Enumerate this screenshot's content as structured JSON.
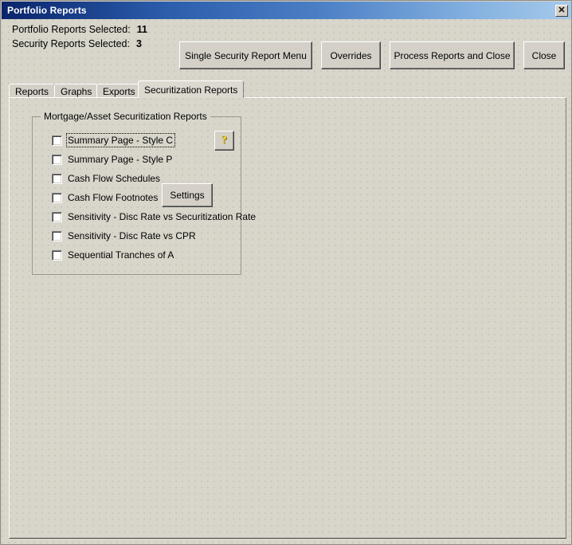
{
  "window": {
    "title": "Portfolio Reports",
    "close_icon": "close-x-icon",
    "close_glyph": "✕"
  },
  "header": {
    "counts": [
      {
        "label": "Portfolio Reports Selected:",
        "value": "11"
      },
      {
        "label": "Security Reports Selected:",
        "value": "3"
      }
    ],
    "buttons": [
      {
        "id": "single-security-report-menu",
        "label": "Single Security Report Menu"
      },
      {
        "id": "overrides",
        "label": "Overrides"
      },
      {
        "id": "process-reports-and-close",
        "label": "Process Reports and Close"
      },
      {
        "id": "close",
        "label": "Close"
      }
    ]
  },
  "tabs": [
    {
      "id": "reports",
      "label": "Reports",
      "active": false
    },
    {
      "id": "graphs",
      "label": "Graphs",
      "active": false
    },
    {
      "id": "exports",
      "label": "Exports",
      "active": false
    },
    {
      "id": "securitization-reports",
      "label": "Securitization Reports",
      "active": true
    }
  ],
  "groupbox": {
    "title": "Mortgage/Asset Securitization Reports",
    "help_button": {
      "icon": "question-mark-icon",
      "glyph": "?"
    },
    "settings_button": {
      "label": "Settings"
    },
    "checkboxes": [
      {
        "id": "summary-page-style-c",
        "label": "Summary Page - Style C",
        "checked": false,
        "focused": true
      },
      {
        "id": "summary-page-style-p",
        "label": "Summary Page - Style P",
        "checked": false,
        "focused": false
      },
      {
        "id": "cash-flow-schedules",
        "label": "Cash Flow Schedules",
        "checked": false,
        "focused": false
      },
      {
        "id": "cash-flow-footnotes",
        "label": "Cash Flow Footnotes",
        "checked": false,
        "focused": false
      },
      {
        "id": "sensitivity-disc-rate-vs-securitization-rate",
        "label": "Sensitivity - Disc Rate vs Securitization Rate",
        "checked": false,
        "focused": false
      },
      {
        "id": "sensitivity-disc-rate-vs-cpr",
        "label": "Sensitivity - Disc Rate vs CPR",
        "checked": false,
        "focused": false
      },
      {
        "id": "sequential-tranches-of-a",
        "label": "Sequential Tranches of A",
        "checked": false,
        "focused": false
      }
    ]
  },
  "colors": {
    "window_face": "#d4d0c8",
    "panel_face": "#d8d5cb",
    "titlebar_start": "#0a246a",
    "titlebar_end": "#a6caea",
    "help_glyph": "#e8c80a",
    "text": "#000000"
  }
}
